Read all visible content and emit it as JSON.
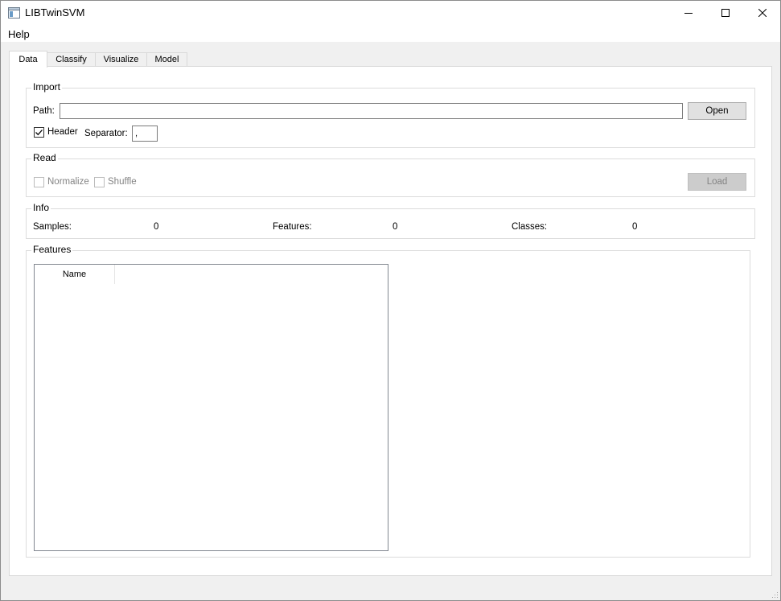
{
  "window": {
    "title": "LIBTwinSVM",
    "minimize_icon": "minimize-icon",
    "maximize_icon": "maximize-icon",
    "close_icon": "close-icon"
  },
  "menu": {
    "items": [
      {
        "label": "Help"
      }
    ]
  },
  "tabs": [
    {
      "label": "Data",
      "active": true
    },
    {
      "label": "Classify",
      "active": false
    },
    {
      "label": "Visualize",
      "active": false
    },
    {
      "label": "Model",
      "active": false
    }
  ],
  "import": {
    "title": "Import",
    "path_label": "Path:",
    "path_value": "",
    "open_label": "Open",
    "header_label": "Header",
    "header_checked": true,
    "separator_label": "Separator:",
    "separator_value": ","
  },
  "read": {
    "title": "Read",
    "normalize_label": "Normalize",
    "normalize_checked": false,
    "shuffle_label": "Shuffle",
    "shuffle_checked": false,
    "load_label": "Load"
  },
  "info": {
    "title": "Info",
    "samples_label": "Samples:",
    "samples_value": "0",
    "features_label": "Features:",
    "features_value": "0",
    "classes_label": "Classes:",
    "classes_value": "0"
  },
  "features": {
    "title": "Features",
    "column_header": "Name",
    "rows": []
  }
}
